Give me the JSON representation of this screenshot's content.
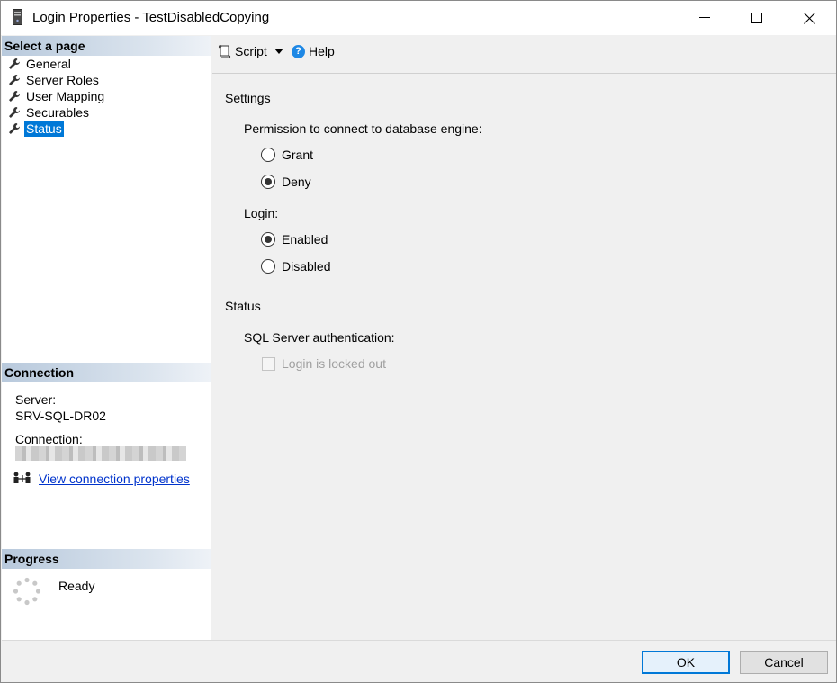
{
  "window": {
    "title": "Login Properties - TestDisabledCopying"
  },
  "left": {
    "select_page_header": "Select a page",
    "pages": [
      {
        "label": "General"
      },
      {
        "label": "Server Roles"
      },
      {
        "label": "User Mapping"
      },
      {
        "label": "Securables"
      },
      {
        "label": "Status"
      }
    ],
    "selected_page": "Status",
    "connection_header": "Connection",
    "server_label": "Server:",
    "server_value": "SRV-SQL-DR02",
    "connection_label": "Connection:",
    "view_connection_link": "View connection properties",
    "progress_header": "Progress",
    "progress_status": "Ready"
  },
  "toolbar": {
    "script_label": "Script",
    "help_label": "Help"
  },
  "settings": {
    "header": "Settings",
    "permission_label": "Permission to connect to database engine:",
    "grant_label": "Grant",
    "deny_label": "Deny",
    "permission_selected": "Deny",
    "login_label": "Login:",
    "enabled_label": "Enabled",
    "disabled_label": "Disabled",
    "login_selected": "Enabled"
  },
  "status": {
    "header": "Status",
    "sql_auth_label": "SQL Server authentication:",
    "locked_out_label": "Login is locked out",
    "locked_out_checked": false
  },
  "buttons": {
    "ok_label": "OK",
    "cancel_label": "Cancel"
  },
  "colors": {
    "selection": "#0078d7",
    "link": "#0033cc"
  }
}
